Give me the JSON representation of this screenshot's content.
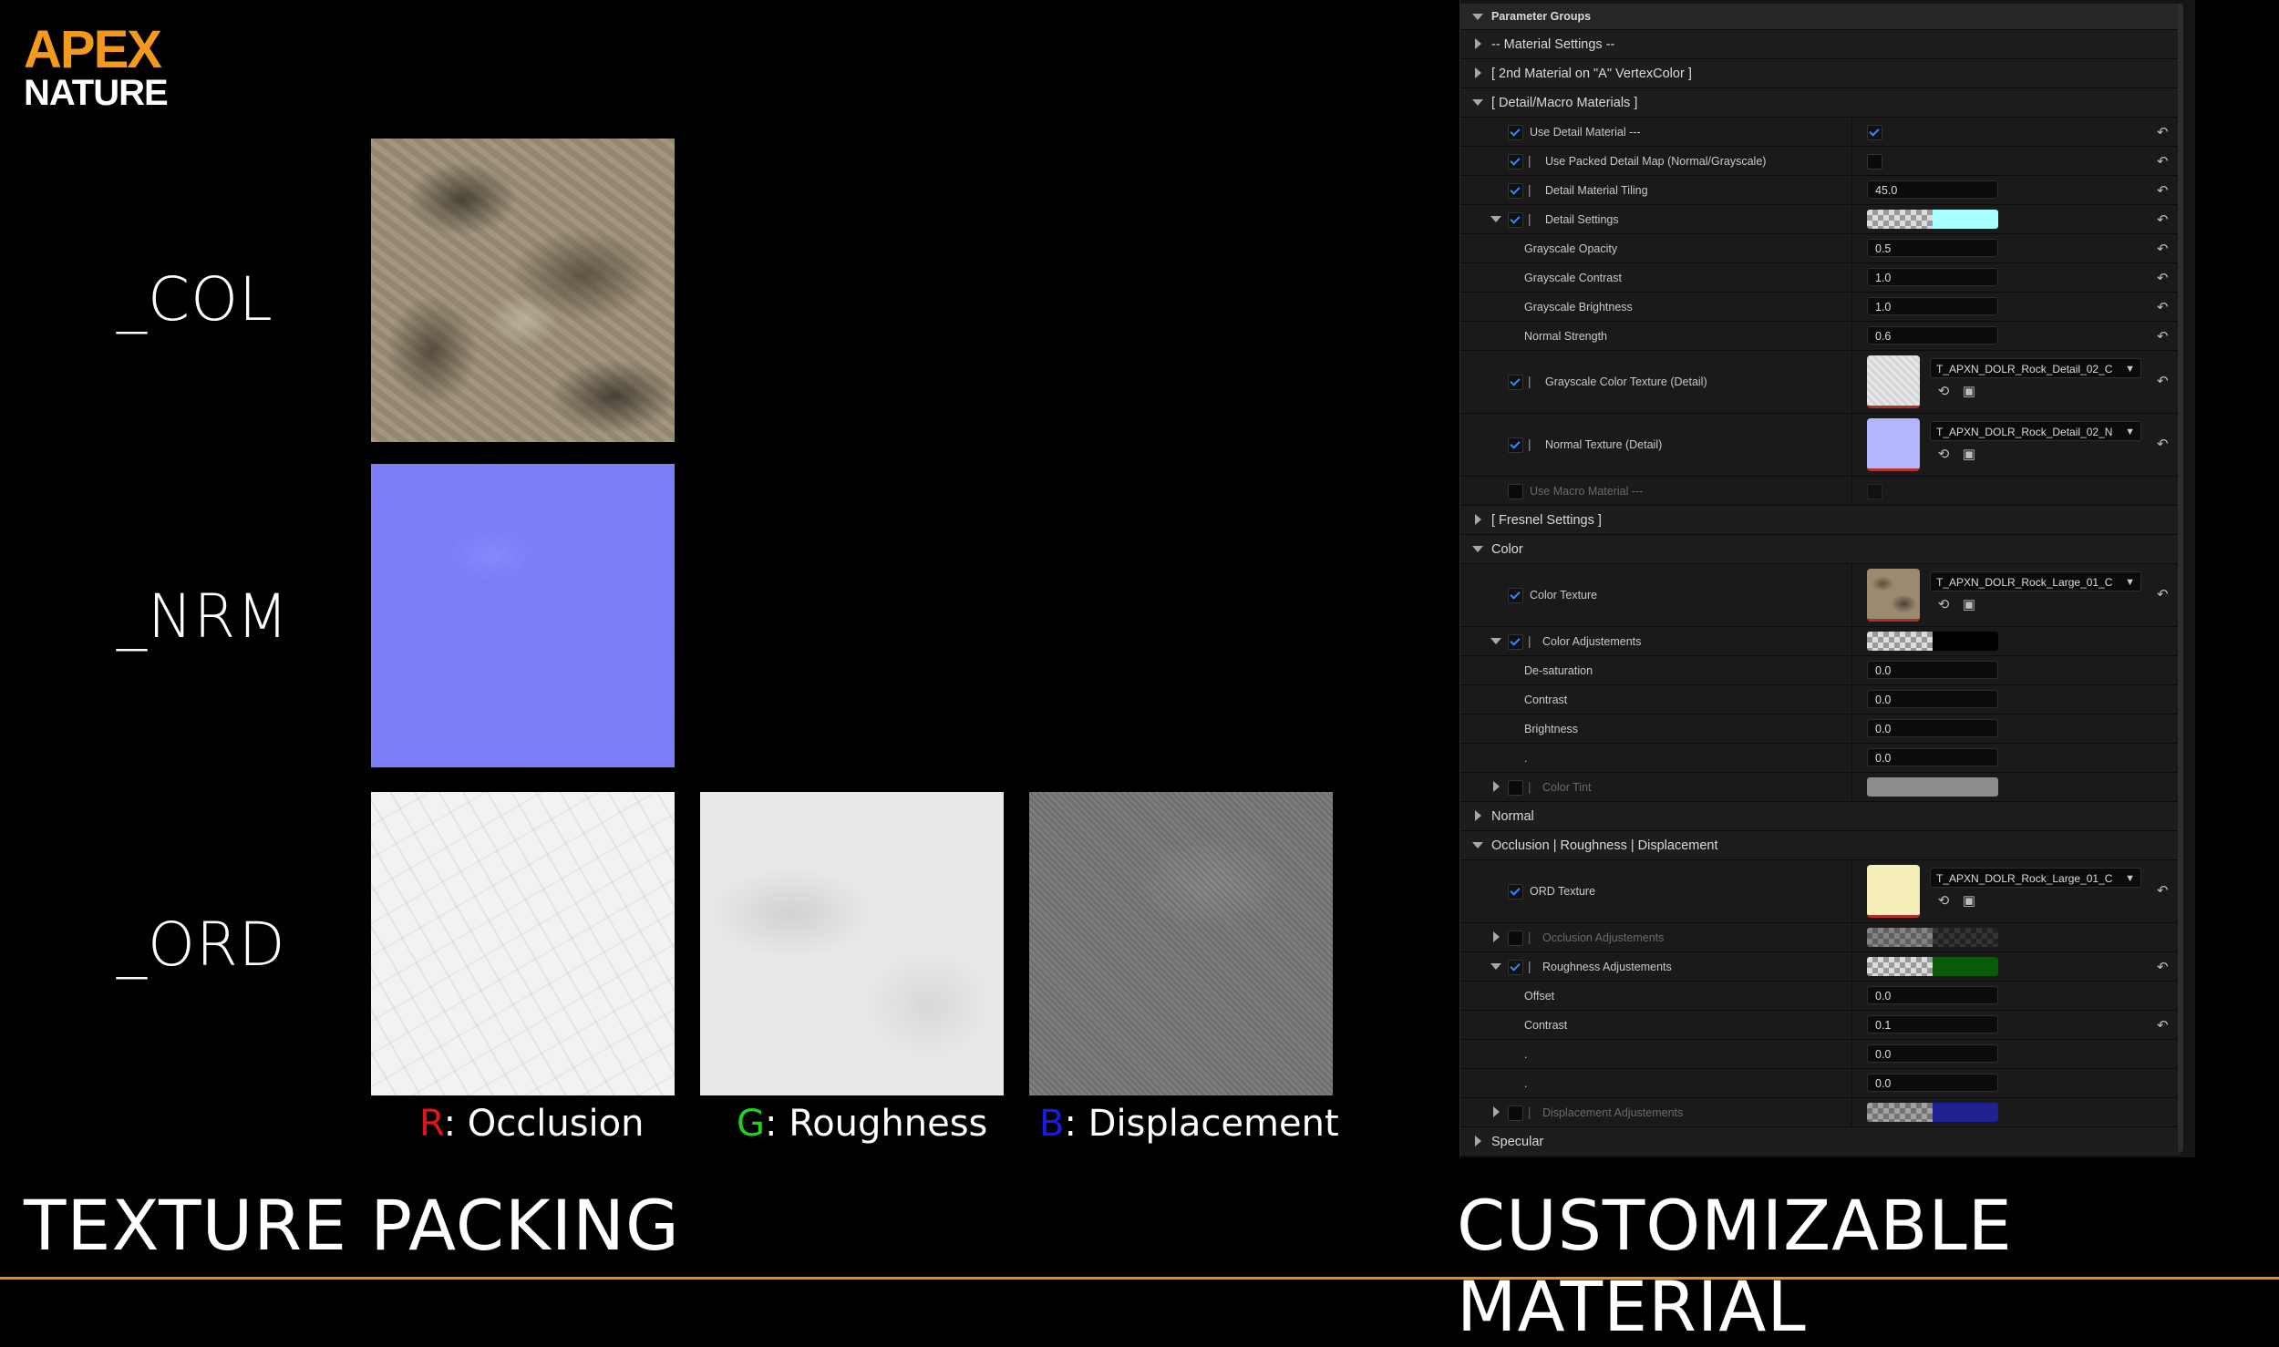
{
  "logo": {
    "line1": "APEX",
    "line2": "NATURE"
  },
  "texture_labels": {
    "col": "_COL",
    "nrm": "_NRM",
    "ord": "_ORD"
  },
  "channels": [
    {
      "letter": "R",
      "text": ": Occlusion",
      "color": "#e0141e"
    },
    {
      "letter": "G",
      "text": ": Roughness",
      "color": "#1fd21f"
    },
    {
      "letter": "B",
      "text": ": Displacement",
      "color": "#1a1ae6"
    }
  ],
  "titles": {
    "left": "TEXTURE PACKING",
    "right": "CUSTOMIZABLE MATERIAL"
  },
  "panel": {
    "header": "Parameter Groups",
    "groups": {
      "material_settings": "-- Material Settings --",
      "second_material": "[ 2nd Material on \"A\" VertexColor ]",
      "detail_macro": "[ Detail/Macro Materials ]",
      "fresnel": "[ Fresnel Settings ]",
      "color": "Color",
      "normal": "Normal",
      "ord": "Occlusion | Roughness | Displacement",
      "specular": "Specular"
    },
    "params": {
      "use_detail": "Use Detail Material  ---",
      "use_packed": "Use Packed Detail Map (Normal/Grayscale)",
      "detail_tiling": "Detail Material Tiling",
      "detail_tiling_val": "45.0",
      "detail_settings": "Detail Settings",
      "gs_opacity": "Grayscale Opacity",
      "gs_opacity_val": "0.5",
      "gs_contrast": "Grayscale Contrast",
      "gs_contrast_val": "1.0",
      "gs_brightness": "Grayscale Brightness",
      "gs_brightness_val": "1.0",
      "normal_strength": "Normal Strength",
      "normal_strength_val": "0.6",
      "gs_color_tex": "Grayscale Color Texture (Detail)",
      "gs_color_tex_asset": "T_APXN_DOLR_Rock_Detail_02_C",
      "normal_tex": "Normal Texture (Detail)",
      "normal_tex_asset": "T_APXN_DOLR_Rock_Detail_02_N",
      "use_macro": "Use Macro Material  ---",
      "color_tex": "Color Texture",
      "color_tex_asset": "T_APXN_DOLR_Rock_Large_01_C",
      "color_adj": "Color Adjustements",
      "desat": "De-saturation",
      "desat_val": "0.0",
      "contrast": "Contrast",
      "contrast_val": "0.0",
      "brightness": "Brightness",
      "brightness_val": "0.0",
      "dot1": ".",
      "dot1_val": "0.0",
      "color_tint": "Color Tint",
      "ord_tex": "ORD Texture",
      "ord_tex_asset": "T_APXN_DOLR_Rock_Large_01_C",
      "occ_adj": "Occlusion Adjustements",
      "rough_adj": "Roughness Adjustements",
      "offset": "Offset",
      "offset_val": "0.0",
      "r_contrast": "Contrast",
      "r_contrast_val": "0.1",
      "dot2": ".",
      "dot2_val": "0.0",
      "dot3": ".",
      "dot3_val": "0.0",
      "disp_adj": "Displacement Adjustements"
    },
    "pipe": "|",
    "colors": {
      "detail_settings_b": "#a8ffff",
      "color_adj_b": "#000000",
      "color_tint": "#8c8c8c",
      "occ_b": "#303030",
      "rough_b": "#0b5a0b",
      "disp_b": "#2424c8"
    }
  }
}
